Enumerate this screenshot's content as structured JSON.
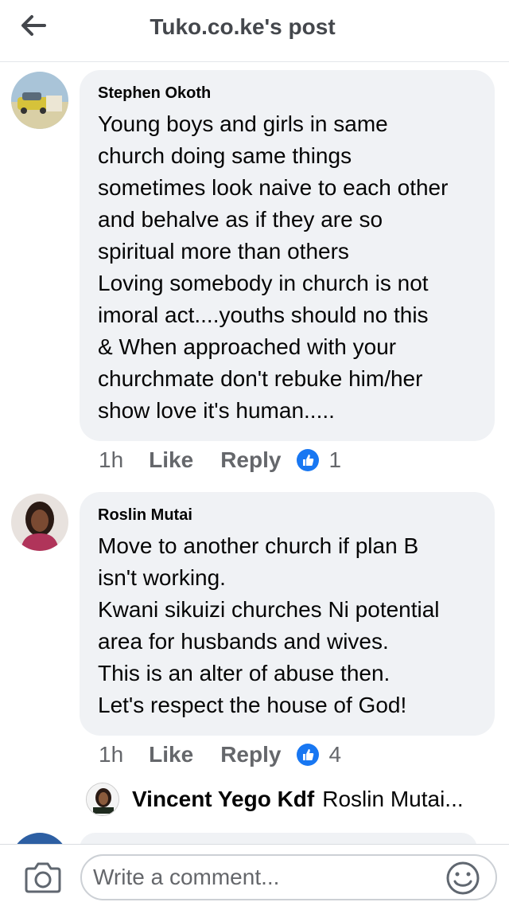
{
  "header": {
    "title": "Tuko.co.ke's post",
    "back_icon": "back-arrow-icon"
  },
  "comments": [
    {
      "author": "Stephen Okoth",
      "text": "Young boys and girls  in same\nchurch doing same things\nsometimes look naive to each other\nand behalve as if they are so\nspiritual more than others\nLoving somebody in church is not\nimoral act....youths should no this\n& When approached with your\nchurchmate don't rebuke him/her\nshow love it's human.....",
      "time": "1h",
      "like_label": "Like",
      "reply_label": "Reply",
      "like_count": "1"
    },
    {
      "author": "Roslin Mutai",
      "text": "Move to another church if plan B\nisn't working.\nKwani sikuizi churches Ni potential\narea for husbands and wives.\nThis is an alter of abuse then.\nLet's respect the house of God!",
      "time": "1h",
      "like_label": "Like",
      "reply_label": "Reply",
      "like_count": "4",
      "reply_preview": {
        "author": "Vincent Yego Kdf",
        "text": "Roslin Mutai..."
      }
    }
  ],
  "composer": {
    "placeholder": "Write a comment...",
    "camera_icon": "camera-icon",
    "emoji_icon": "emoji-icon"
  },
  "colors": {
    "like_blue": "#1877f2",
    "bubble_gray": "#f0f2f5",
    "meta_gray": "#65676b"
  }
}
